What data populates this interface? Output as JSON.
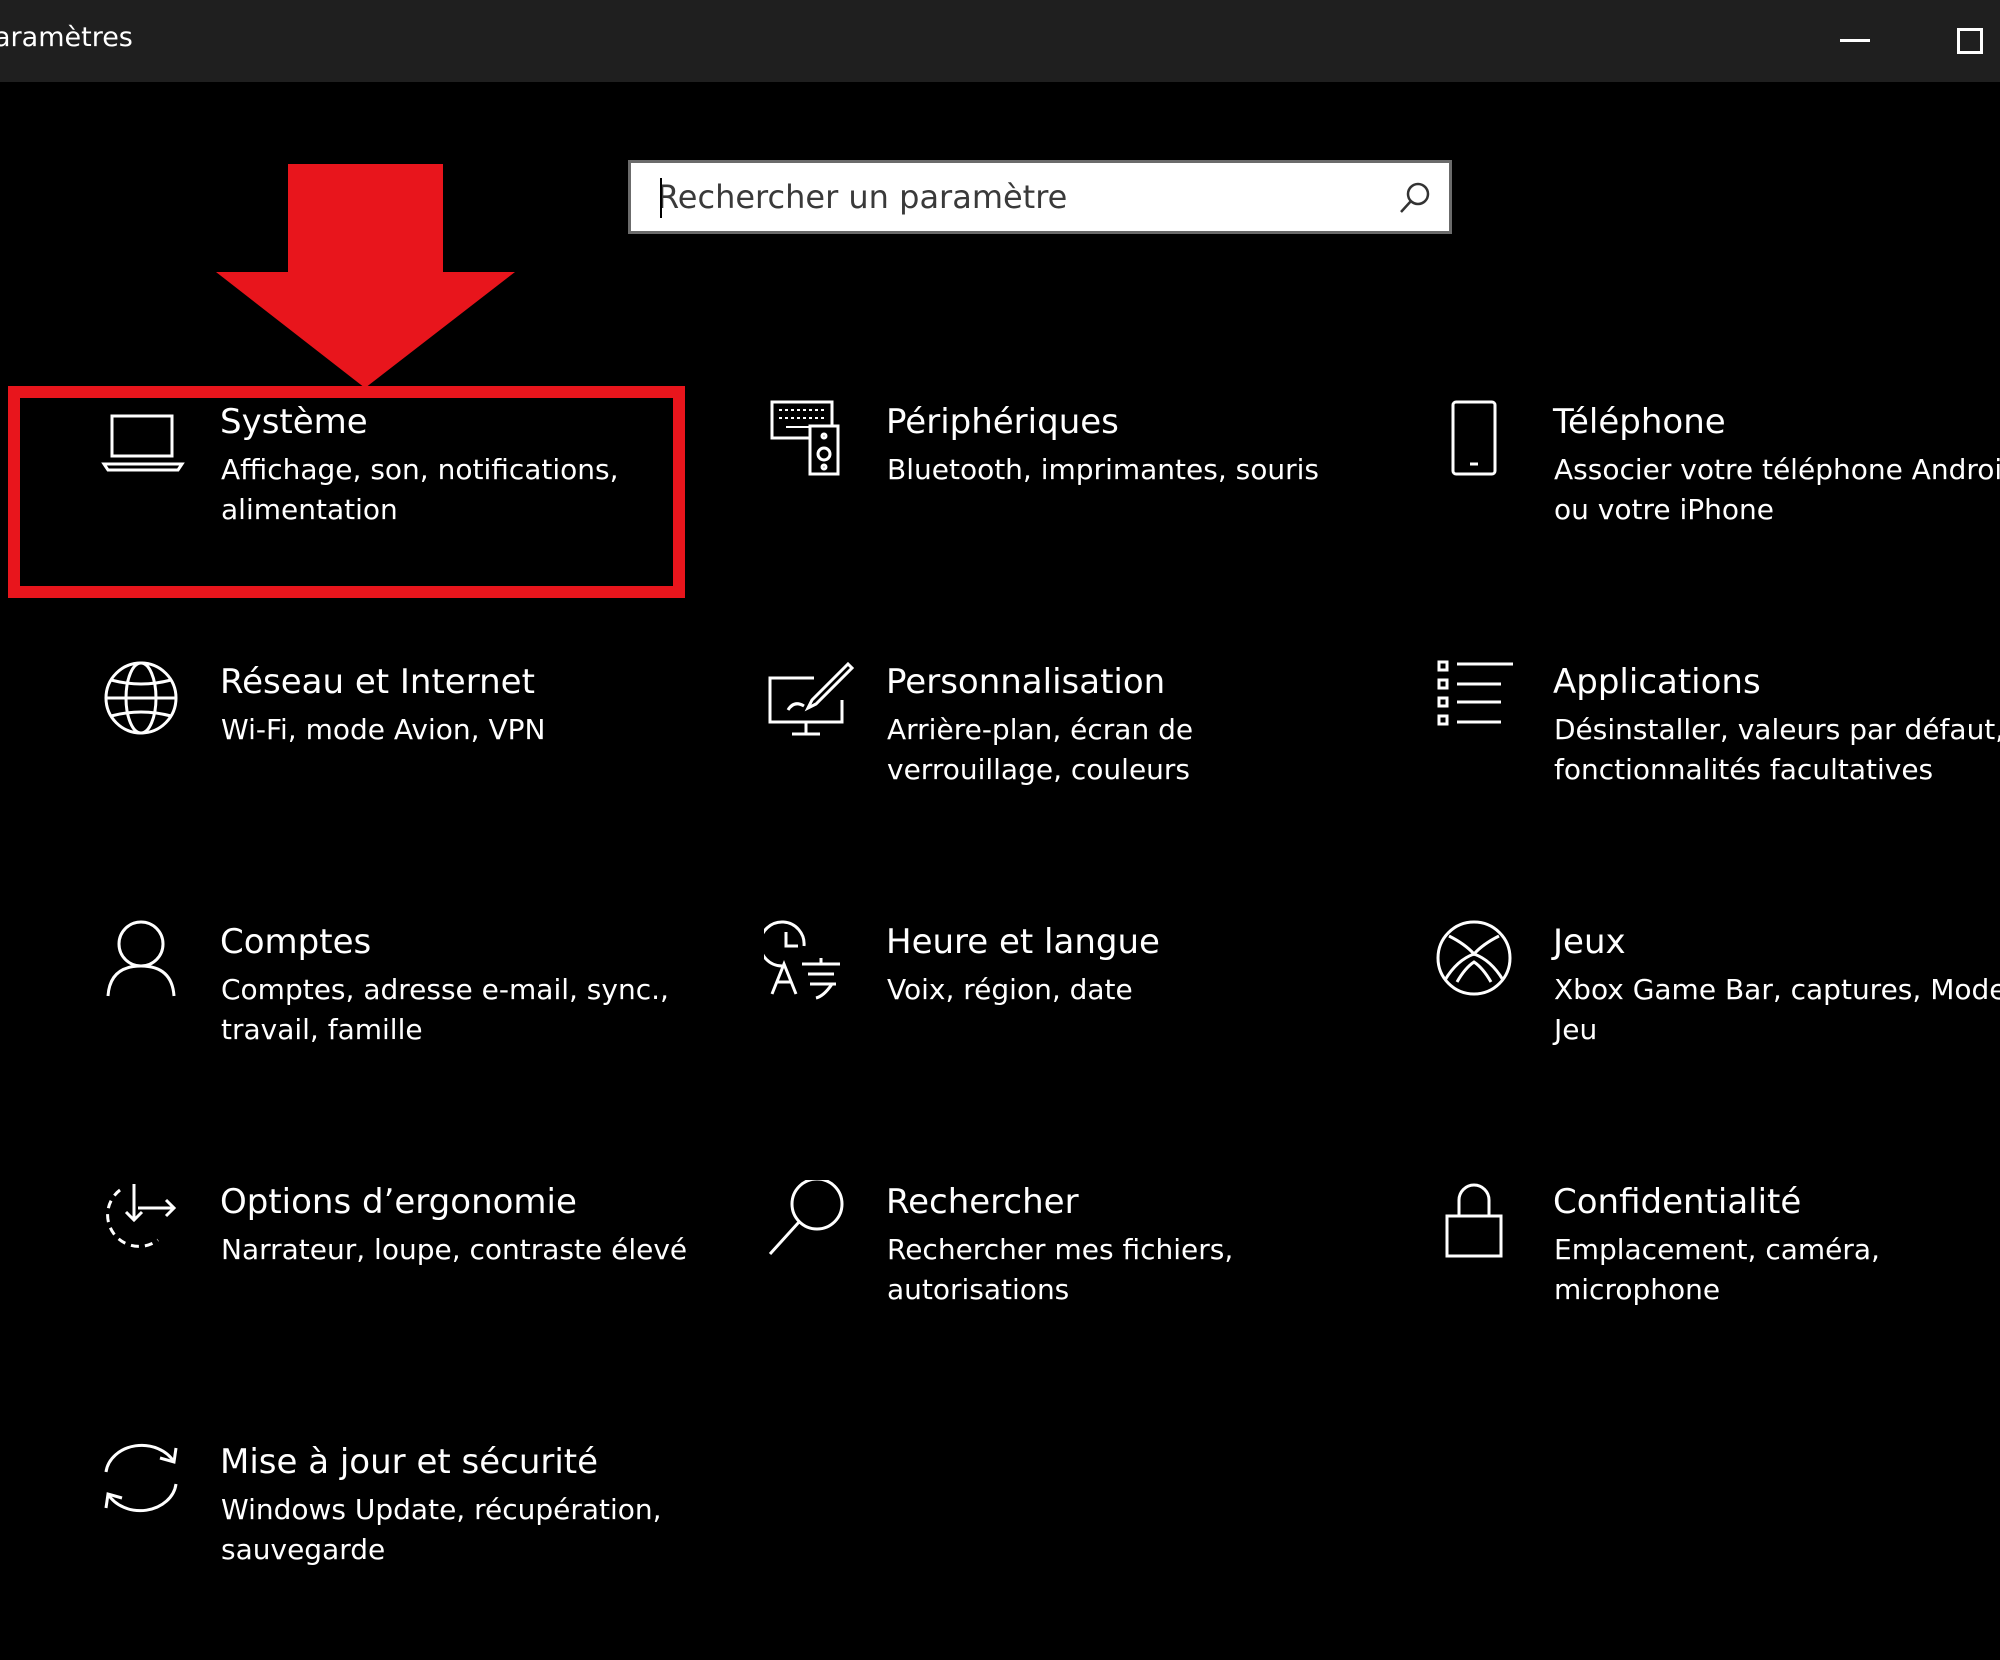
{
  "window": {
    "title": "aramètres",
    "minimize_icon": "minimize-icon",
    "maximize_icon": "maximize-icon"
  },
  "search": {
    "placeholder": "Rechercher un paramètre",
    "icon": "search-icon"
  },
  "annotation": {
    "arrow_color": "#e8151c",
    "highlight_color": "#e8151c",
    "highlighted_tile": "Système"
  },
  "tiles": [
    {
      "title": "Système",
      "desc": "Affichage, son, notifications, alimentation",
      "icon": "laptop-icon"
    },
    {
      "title": "Périphériques",
      "desc": "Bluetooth, imprimantes, souris",
      "icon": "devices-icon"
    },
    {
      "title": "Téléphone",
      "desc": "Associer votre téléphone Android ou votre iPhone",
      "icon": "phone-icon"
    },
    {
      "title": "Réseau et Internet",
      "desc": "Wi-Fi, mode Avion, VPN",
      "icon": "globe-icon"
    },
    {
      "title": "Personnalisation",
      "desc": "Arrière-plan, écran de verrouillage, couleurs",
      "icon": "personalization-icon"
    },
    {
      "title": "Applications",
      "desc": "Désinstaller, valeurs par défaut, fonctionnalités facultatives",
      "icon": "apps-list-icon"
    },
    {
      "title": "Comptes",
      "desc": "Comptes, adresse e-mail, sync., travail, famille",
      "icon": "person-icon"
    },
    {
      "title": "Heure et langue",
      "desc": "Voix, région, date",
      "icon": "time-language-icon"
    },
    {
      "title": "Jeux",
      "desc": "Xbox Game Bar, captures, Mode Jeu",
      "icon": "xbox-icon"
    },
    {
      "title": "Options d’ergonomie",
      "desc": "Narrateur, loupe, contraste élevé",
      "icon": "ease-of-access-icon"
    },
    {
      "title": "Rechercher",
      "desc": "Rechercher mes fichiers, autorisations",
      "icon": "search-icon"
    },
    {
      "title": "Confidentialité",
      "desc": "Emplacement, caméra, microphone",
      "icon": "lock-icon"
    },
    {
      "title": "Mise à jour et sécurité",
      "desc": "Windows Update, récupération, sauvegarde",
      "icon": "update-sync-icon"
    }
  ]
}
